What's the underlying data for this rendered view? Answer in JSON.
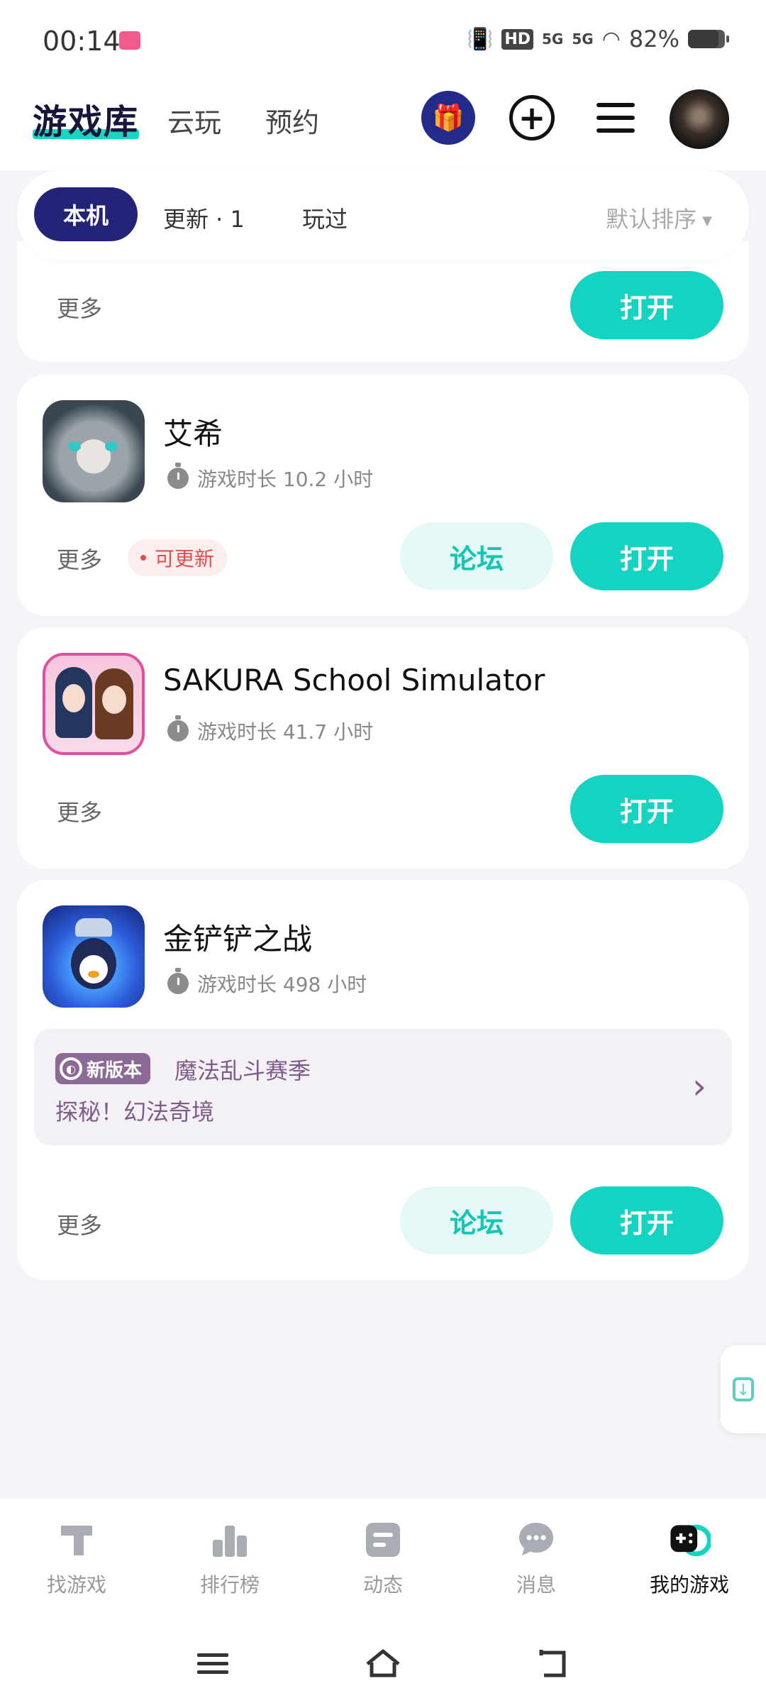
{
  "status_bar": {
    "time": "00:14",
    "hd": "HD",
    "net1": "5G",
    "net2": "5G",
    "battery": "82%"
  },
  "header": {
    "tabs": [
      {
        "label": "游戏库"
      },
      {
        "label": "云玩"
      },
      {
        "label": "预约"
      }
    ]
  },
  "filter": {
    "chips": [
      {
        "label": "本机"
      },
      {
        "label": "更新 · 1"
      },
      {
        "label": "玩过"
      }
    ],
    "sort": "默认排序"
  },
  "cards": [
    {
      "more": "更多",
      "open": "打开"
    },
    {
      "title": "艾希",
      "playtime": "游戏时长 10.2 小时",
      "more": "更多",
      "badge": "可更新",
      "forum": "论坛",
      "open": "打开"
    },
    {
      "title": "SAKURA School Simulator",
      "playtime": "游戏时长 41.7 小时",
      "more": "更多",
      "open": "打开"
    },
    {
      "title": "金铲铲之战",
      "playtime": "游戏时长 498 小时",
      "more": "更多",
      "forum": "论坛",
      "open": "打开",
      "promo": {
        "badge": "新版本",
        "title": "魔法乱斗赛季",
        "subtitle": "探秘！幻法奇境"
      }
    }
  ],
  "bottom_nav": [
    {
      "label": "找游戏",
      "icon": "find-game-icon"
    },
    {
      "label": "排行榜",
      "icon": "ranking-icon"
    },
    {
      "label": "动态",
      "icon": "feed-icon"
    },
    {
      "label": "消息",
      "icon": "message-icon"
    },
    {
      "label": "我的游戏",
      "icon": "my-games-icon",
      "active": true
    }
  ],
  "colors": {
    "accent": "#14d4c1",
    "chip_active": "#232478",
    "promo": "#7e5c8a",
    "update": "#e44d4d"
  }
}
